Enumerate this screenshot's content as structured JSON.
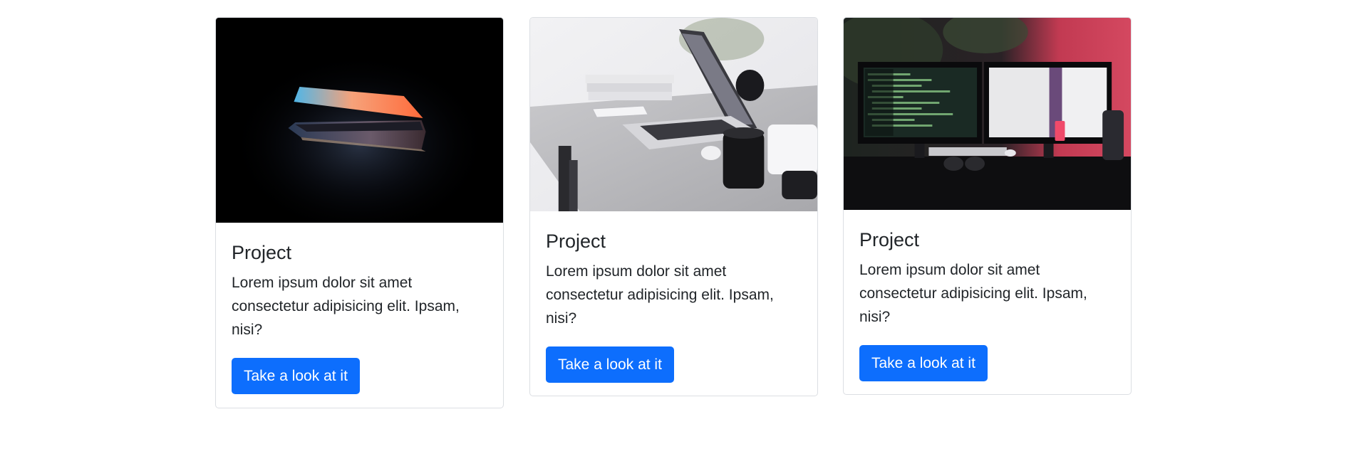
{
  "cards": [
    {
      "image": "laptop-dark-photo",
      "title": "Project",
      "text": "Lorem ipsum dolor sit amet consectetur adipisicing elit. Ipsam, nisi?",
      "button_label": "Take a look at it"
    },
    {
      "image": "desk-laptop-photo",
      "title": "Project",
      "text": "Lorem ipsum dolor sit amet consectetur adipisicing elit. Ipsam, nisi?",
      "button_label": "Take a look at it"
    },
    {
      "image": "workstation-monitors-photo",
      "title": "Project",
      "text": "Lorem ipsum dolor sit amet consectetur adipisicing elit. Ipsam, nisi?",
      "button_label": "Take a look at it"
    }
  ],
  "colors": {
    "button_bg": "#0d6efd",
    "button_text": "#ffffff",
    "card_border": "#dcdfe3",
    "text": "#212529"
  }
}
